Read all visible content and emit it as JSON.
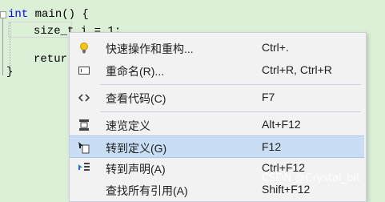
{
  "editor": {
    "line1": {
      "keyword": "int",
      "rest": " main() {"
    },
    "line2": "size_t i = 1;",
    "line3": "retur",
    "line4": "}"
  },
  "context_menu": {
    "items": [
      {
        "label": "快速操作和重构...",
        "shortcut": "Ctrl+.",
        "icon": "lightbulb-icon"
      },
      {
        "label": "重命名(R)...",
        "shortcut": "Ctrl+R, Ctrl+R",
        "icon": "rename-icon"
      },
      {
        "label": "查看代码(C)",
        "shortcut": "F7",
        "icon": "code-brackets-icon"
      },
      {
        "label": "速览定义",
        "shortcut": "Alt+F12",
        "icon": "peek-definition-icon"
      },
      {
        "label": "转到定义(G)",
        "shortcut": "F12",
        "icon": "go-to-definition-icon",
        "selected": true
      },
      {
        "label": "转到声明(A)",
        "shortcut": "Ctrl+F12",
        "icon": "go-to-declaration-icon"
      },
      {
        "label": "查找所有引用(A)",
        "shortcut": "Shift+F12",
        "icon": ""
      }
    ]
  },
  "watermark": "CSDN @Crystal_bit",
  "colors": {
    "editor_background": "#dcf0d8",
    "menu_background": "#f2f2f2",
    "selected_background": "#c9def5",
    "keyword": "#0000ff"
  }
}
